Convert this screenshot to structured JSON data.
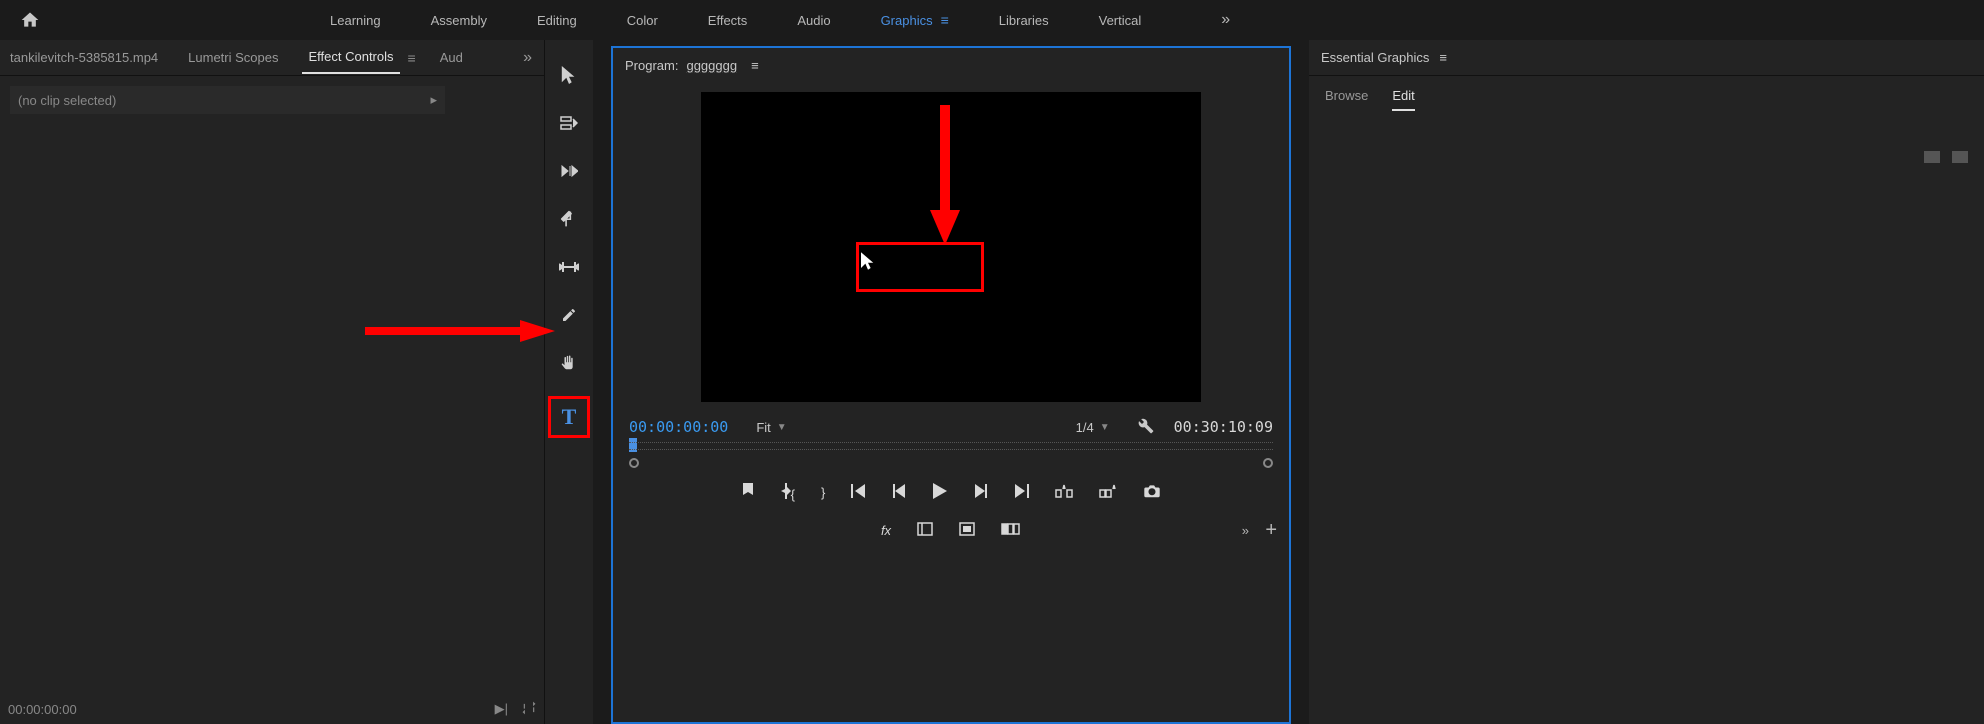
{
  "workspace_tabs": {
    "learning": "Learning",
    "assembly": "Assembly",
    "editing": "Editing",
    "color": "Color",
    "effects": "Effects",
    "audio": "Audio",
    "graphics": "Graphics",
    "libraries": "Libraries",
    "vertical": "Vertical"
  },
  "left_panel": {
    "tab_source": "tankilevitch-5385815.mp4",
    "tab_lumetri": "Lumetri Scopes",
    "tab_effect_controls": "Effect Controls",
    "tab_audio": "Aud",
    "no_clip": "(no clip selected)",
    "footer_time": "00:00:00:00"
  },
  "program": {
    "label": "Program:",
    "sequence_name": "ggggggg",
    "time_current": "00:00:00:00",
    "time_total": "00:30:10:09",
    "zoom_fit": "Fit",
    "playback_res": "1/4"
  },
  "right_panel": {
    "title": "Essential Graphics",
    "tab_browse": "Browse",
    "tab_edit": "Edit"
  }
}
